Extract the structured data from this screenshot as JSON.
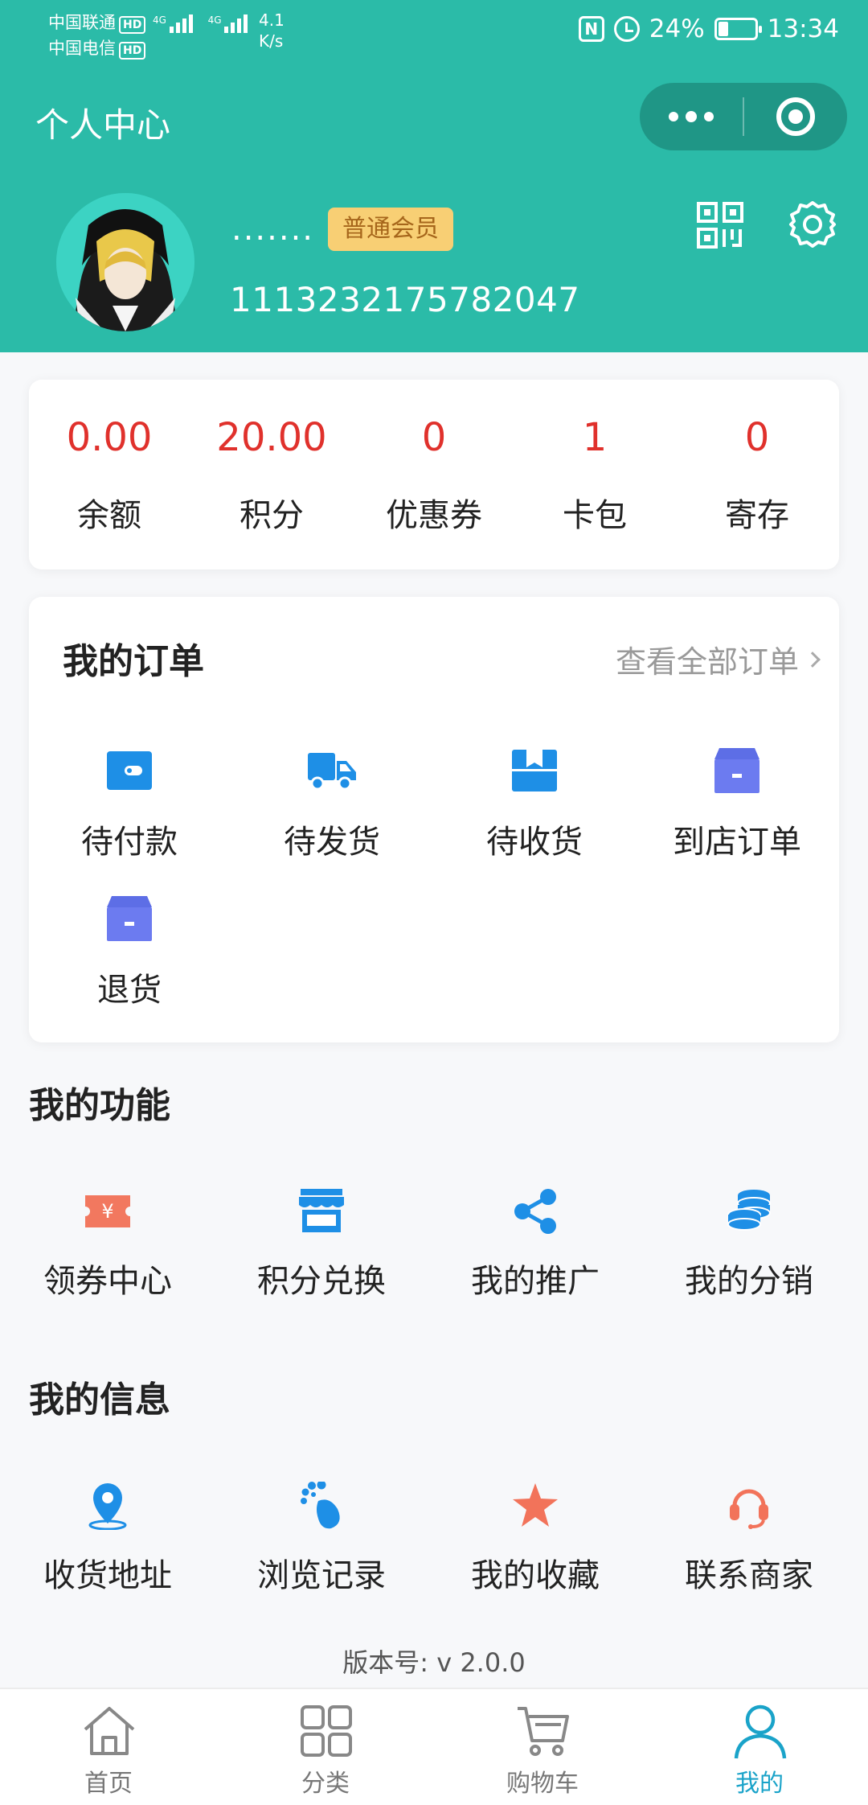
{
  "status_bar": {
    "carrier_1": "中国联通",
    "carrier_2": "中国电信",
    "hd": "HD",
    "net_type": "4G",
    "speed": "4.1",
    "speed_unit": "K/s",
    "nfc": "N",
    "battery": "24%",
    "time": "13:34"
  },
  "header": {
    "title": "个人中心",
    "nickname": ".......",
    "member_level": "普通会员",
    "user_id": "1113232175782047",
    "icons": [
      "qr-code-icon",
      "settings-icon"
    ]
  },
  "stats": [
    {
      "value": "0.00",
      "label": "余额"
    },
    {
      "value": "20.00",
      "label": "积分"
    },
    {
      "value": "0",
      "label": "优惠券"
    },
    {
      "value": "1",
      "label": "卡包"
    },
    {
      "value": "0",
      "label": "寄存"
    }
  ],
  "orders": {
    "title": "我的订单",
    "view_all": "查看全部订单",
    "items": [
      {
        "label": "待付款",
        "icon": "wallet-icon"
      },
      {
        "label": "待发货",
        "icon": "truck-icon"
      },
      {
        "label": "待收货",
        "icon": "package-icon"
      },
      {
        "label": "到店订单",
        "icon": "store-icon"
      },
      {
        "label": "退货",
        "icon": "return-icon"
      }
    ]
  },
  "functions": {
    "title": "我的功能",
    "items": [
      {
        "label": "领券中心",
        "icon": "coupon-icon"
      },
      {
        "label": "积分兑换",
        "icon": "shop-icon"
      },
      {
        "label": "我的推广",
        "icon": "share-icon"
      },
      {
        "label": "我的分销",
        "icon": "coins-icon"
      }
    ]
  },
  "info": {
    "title": "我的信息",
    "items": [
      {
        "label": "收货地址",
        "icon": "location-icon"
      },
      {
        "label": "浏览记录",
        "icon": "footprint-icon"
      },
      {
        "label": "我的收藏",
        "icon": "star-icon"
      },
      {
        "label": "联系商家",
        "icon": "headset-icon"
      }
    ]
  },
  "version": "版本号: v 2.0.0",
  "tabbar": [
    {
      "label": "首页",
      "icon": "home-icon"
    },
    {
      "label": "分类",
      "icon": "category-icon"
    },
    {
      "label": "购物车",
      "icon": "cart-icon"
    },
    {
      "label": "我的",
      "icon": "user-icon",
      "active": true
    }
  ],
  "colors": {
    "brand": "#2bbba8",
    "stat_value": "#e0312c",
    "order_icon": "#1e8fe6",
    "badge_bg": "#f8cf74",
    "tab_active": "#1aa3c9"
  }
}
